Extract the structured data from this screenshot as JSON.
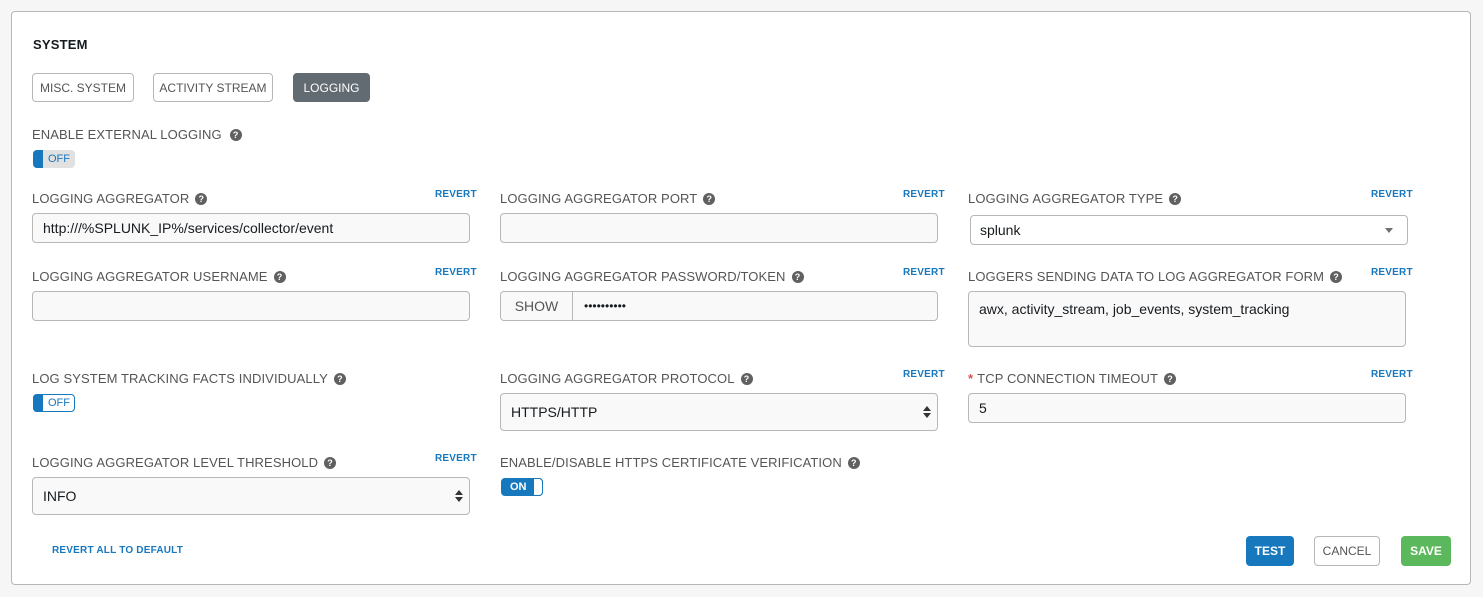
{
  "section_title": "SYSTEM",
  "tabs": [
    {
      "label": "MISC. SYSTEM",
      "active": false
    },
    {
      "label": "ACTIVITY STREAM",
      "active": false
    },
    {
      "label": "LOGGING",
      "active": true
    }
  ],
  "revert_label": "REVERT",
  "help_glyph": "?",
  "fields": {
    "enable_external_logging": {
      "label": "ENABLE EXTERNAL LOGGING",
      "toggle": "OFF"
    },
    "logging_aggregator": {
      "label": "LOGGING AGGREGATOR",
      "value": "http:///%SPLUNK_IP%/services/collector/event"
    },
    "logging_aggregator_port": {
      "label": "LOGGING AGGREGATOR PORT",
      "value": ""
    },
    "logging_aggregator_type": {
      "label": "LOGGING AGGREGATOR TYPE",
      "value": "splunk"
    },
    "logging_aggregator_username": {
      "label": "LOGGING AGGREGATOR USERNAME",
      "value": ""
    },
    "logging_aggregator_password": {
      "label": "LOGGING AGGREGATOR PASSWORD/TOKEN",
      "show_label": "SHOW",
      "value": "••••••••••"
    },
    "loggers": {
      "label": "LOGGERS SENDING DATA TO LOG AGGREGATOR FORM",
      "value": "awx, activity_stream, job_events, system_tracking"
    },
    "log_system_tracking": {
      "label": "LOG SYSTEM TRACKING FACTS INDIVIDUALLY",
      "toggle": "OFF"
    },
    "protocol": {
      "label": "LOGGING AGGREGATOR PROTOCOL",
      "value": "HTTPS/HTTP"
    },
    "tcp_timeout": {
      "label": "TCP CONNECTION TIMEOUT",
      "required_mark": "*",
      "value": "5"
    },
    "level_threshold": {
      "label": "LOGGING AGGREGATOR LEVEL THRESHOLD",
      "value": "INFO"
    },
    "cert_verification": {
      "label": "ENABLE/DISABLE HTTPS CERTIFICATE VERIFICATION",
      "toggle": "ON"
    }
  },
  "footer": {
    "revert_all": "REVERT ALL TO DEFAULT",
    "test": "TEST",
    "cancel": "CANCEL",
    "save": "SAVE"
  },
  "colors": {
    "accent": "#1778be",
    "save": "#5cb85c",
    "active_tab": "#626a72",
    "required": "#d9534f"
  }
}
